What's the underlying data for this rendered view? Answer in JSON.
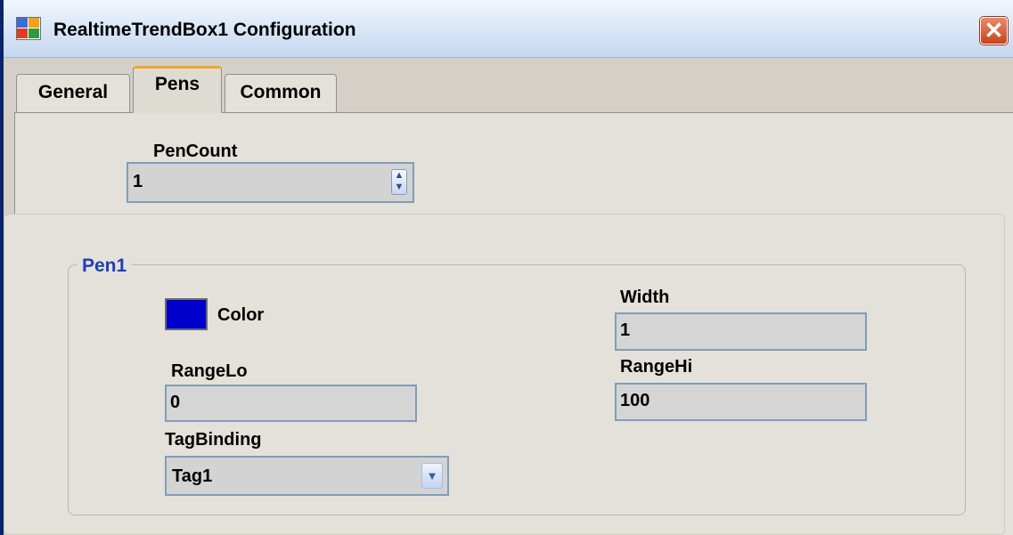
{
  "window": {
    "title": "RealtimeTrendBox1 Configuration",
    "close_glyph": "✕",
    "app_icon": "app-grid-icon"
  },
  "tabs": [
    {
      "label": "General",
      "active": false
    },
    {
      "label": "Pens",
      "active": true
    },
    {
      "label": "Common",
      "active": false
    }
  ],
  "pen_count": {
    "label": "PenCount",
    "value": "1",
    "spin_up": "▲",
    "spin_down": "▼"
  },
  "pen1": {
    "group_title": "Pen1",
    "color_label": "Color",
    "color_value": "#0000cc",
    "width_label": "Width",
    "width_value": "1",
    "range_lo_label": "RangeLo",
    "range_lo_value": "0",
    "range_hi_label": "RangeHi",
    "range_hi_value": "100",
    "tag_binding_label": "TagBinding",
    "tag_binding_value": "Tag1",
    "dropdown_glyph": "▼"
  },
  "colors": {
    "titlebar": "#dce8f8",
    "group_title": "#1b3fb5",
    "active_tab_accent": "#f0a52b",
    "close_button": "#c8431f"
  }
}
